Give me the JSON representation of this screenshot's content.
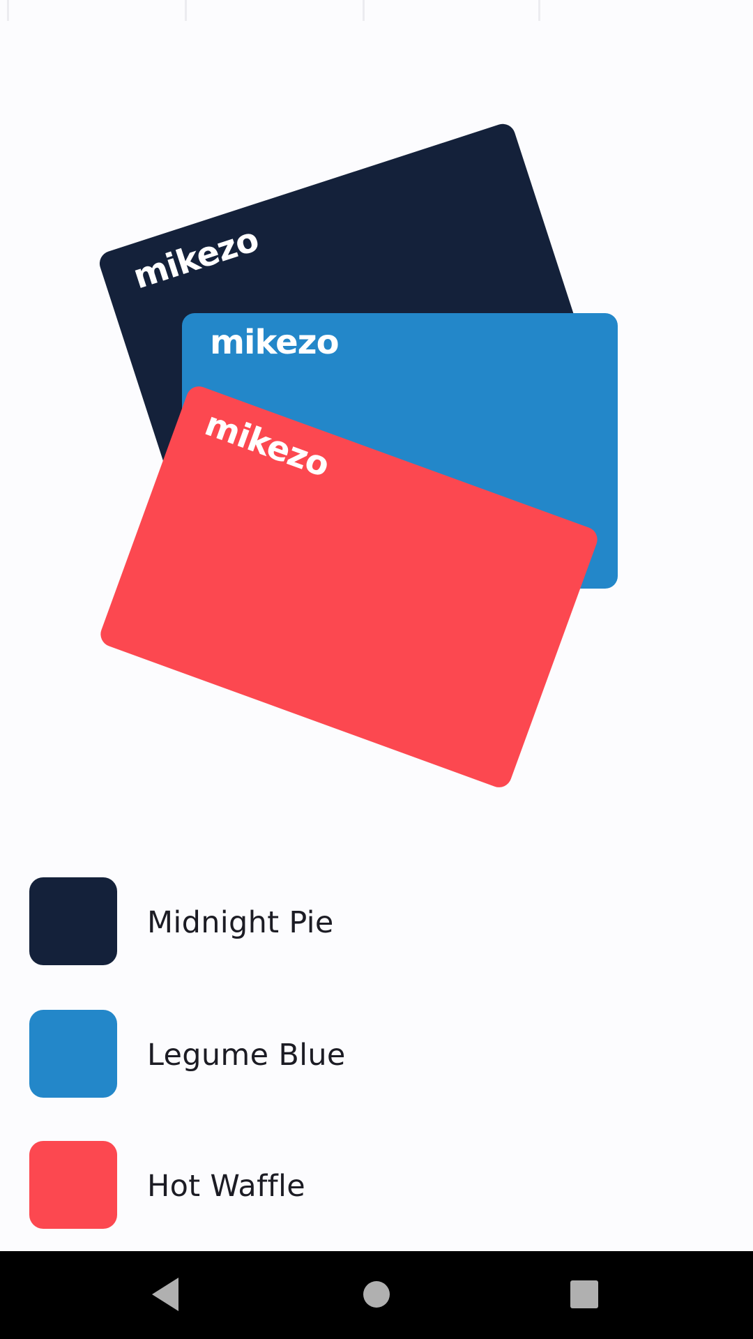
{
  "cards": {
    "dark": {
      "brand": "mikezo",
      "color": "#14213a"
    },
    "blue": {
      "brand": "mikezo",
      "color": "#2387c9"
    },
    "red": {
      "brand": "mikezo",
      "color": "#fc4850"
    }
  },
  "colors": [
    {
      "label": "Midnight Pie",
      "color": "#14213a"
    },
    {
      "label": "Legume Blue",
      "color": "#2387c9"
    },
    {
      "label": "Hot Waffle",
      "color": "#fc4850"
    }
  ],
  "nav": {
    "back_icon": "back-triangle-icon",
    "home_icon": "home-circle-icon",
    "recents_icon": "recents-square-icon",
    "icon_color": "#b0b0b0"
  }
}
